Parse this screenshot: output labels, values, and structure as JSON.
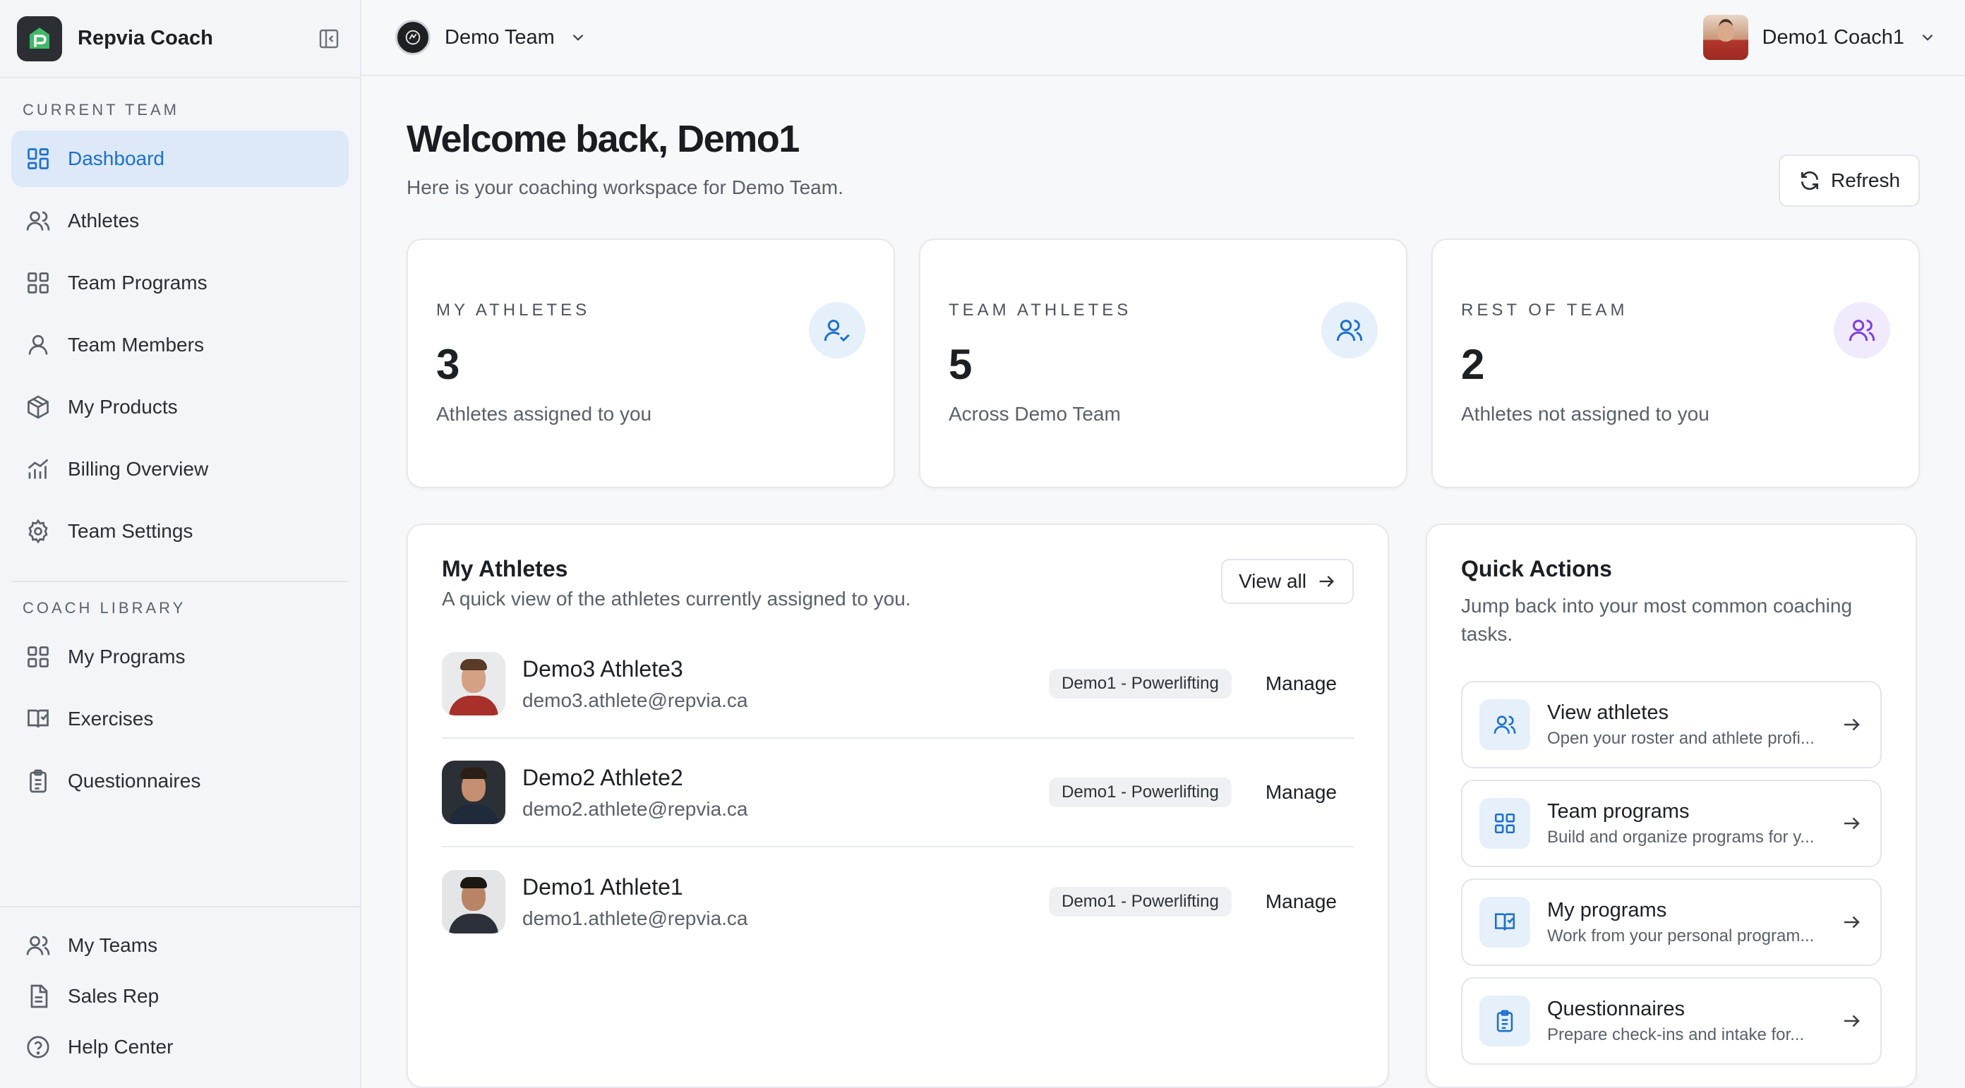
{
  "app": {
    "brand": "Repvia Coach"
  },
  "sidebar": {
    "current_team_label": "CURRENT TEAM",
    "current_team_items": [
      {
        "label": "Dashboard",
        "icon": "dashboard-icon",
        "active": true
      },
      {
        "label": "Athletes",
        "icon": "users-icon"
      },
      {
        "label": "Team Programs",
        "icon": "grid-icon"
      },
      {
        "label": "Team Members",
        "icon": "user-icon"
      },
      {
        "label": "My Products",
        "icon": "box-icon"
      },
      {
        "label": "Billing Overview",
        "icon": "chart-icon"
      },
      {
        "label": "Team Settings",
        "icon": "gear-icon"
      }
    ],
    "coach_library_label": "COACH LIBRARY",
    "coach_library_items": [
      {
        "label": "My Programs",
        "icon": "grid-icon"
      },
      {
        "label": "Exercises",
        "icon": "book-icon"
      },
      {
        "label": "Questionnaires",
        "icon": "clipboard-icon"
      }
    ],
    "bottom_items": [
      {
        "label": "My Teams",
        "icon": "users-icon"
      },
      {
        "label": "Sales Rep",
        "icon": "document-icon"
      },
      {
        "label": "Help Center",
        "icon": "help-icon"
      }
    ]
  },
  "topbar": {
    "team_name": "Demo Team",
    "user_name": "Demo1 Coach1"
  },
  "main": {
    "welcome": "Welcome back, Demo1",
    "subtitle": "Here is your coaching workspace for Demo Team.",
    "refresh_label": "Refresh",
    "stats": [
      {
        "label": "MY ATHLETES",
        "value": "3",
        "desc": "Athletes assigned to you",
        "color": "#1c6fd1",
        "bg": "#e6f0fb"
      },
      {
        "label": "TEAM ATHLETES",
        "value": "5",
        "desc": "Across Demo Team",
        "color": "#1c6fd1",
        "bg": "#e6f0fb"
      },
      {
        "label": "REST OF TEAM",
        "value": "2",
        "desc": "Athletes not assigned to you",
        "color": "#7b3fe4",
        "bg": "#f1eafd"
      }
    ],
    "my_athletes": {
      "title": "My Athletes",
      "subtitle": "A quick view of the athletes currently assigned to you.",
      "view_all": "View all",
      "manage_label": "Manage",
      "athletes": [
        {
          "name": "Demo3 Athlete3",
          "email": "demo3.athlete@repvia.ca",
          "badge": "Demo1 - Powerlifting"
        },
        {
          "name": "Demo2 Athlete2",
          "email": "demo2.athlete@repvia.ca",
          "badge": "Demo1 - Powerlifting"
        },
        {
          "name": "Demo1 Athlete1",
          "email": "demo1.athlete@repvia.ca",
          "badge": "Demo1 - Powerlifting"
        }
      ]
    },
    "quick_actions": {
      "title": "Quick Actions",
      "subtitle": "Jump back into your most common coaching tasks.",
      "items": [
        {
          "title": "View athletes",
          "desc": "Open your roster and athlete profi...",
          "icon": "users-icon"
        },
        {
          "title": "Team programs",
          "desc": "Build and organize programs for y...",
          "icon": "grid-icon"
        },
        {
          "title": "My programs",
          "desc": "Work from your personal program...",
          "icon": "book-icon"
        },
        {
          "title": "Questionnaires",
          "desc": "Prepare check-ins and intake for...",
          "icon": "clipboard-icon"
        }
      ]
    }
  }
}
